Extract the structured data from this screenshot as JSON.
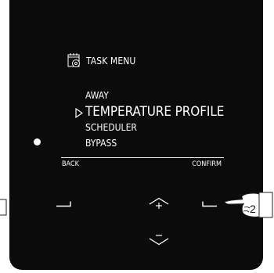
{
  "screen": {
    "menu_icon": "calendar-gear-icon",
    "title": "TASK MENU",
    "items": [
      {
        "label": "AWAY",
        "selected": false
      },
      {
        "label": "TEMPERATURE PROFILE",
        "selected": true
      },
      {
        "label": "SCHEDULER",
        "selected": false
      },
      {
        "label": "BYPASS",
        "selected": false
      }
    ],
    "cursor_icon": "pointer-triangle-icon",
    "softkeys": {
      "left": "BACK",
      "right": "CONFIRM"
    }
  },
  "buttons": {
    "left": "left-softkey-icon",
    "right": "right-softkey-icon",
    "up": "up-plus-icon",
    "down": "down-minus-icon"
  },
  "callout": {
    "icon": "pointing-hand-icon",
    "number": "2"
  },
  "colors": {
    "device": "#0b0b0b",
    "text": "#ffffff",
    "background": "#ffffff"
  }
}
